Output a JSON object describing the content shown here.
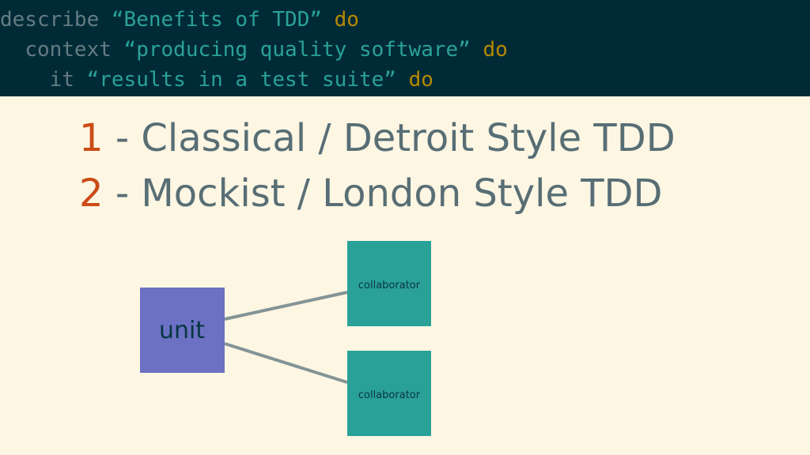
{
  "code": {
    "lines": [
      {
        "indent": "",
        "keyword": "describe",
        "string": "“Benefits of TDD”",
        "tail": "do"
      },
      {
        "indent": "  ",
        "keyword": "context",
        "string": "“producing quality software”",
        "tail": "do"
      },
      {
        "indent": "    ",
        "keyword": "it",
        "string": "“results in a test suite”",
        "tail": "do"
      }
    ]
  },
  "styles": [
    {
      "number": "1",
      "text": "- Classical / Detroit Style TDD"
    },
    {
      "number": "2",
      "text": "- Mockist / London Style TDD"
    }
  ],
  "diagram": {
    "unit": {
      "label": "unit",
      "color": "#6c71c4"
    },
    "collaborators": [
      {
        "label": "collaborator",
        "color": "#2aa198"
      },
      {
        "label": "collaborator",
        "color": "#2aa198"
      }
    ],
    "edge_color": "#839496"
  }
}
